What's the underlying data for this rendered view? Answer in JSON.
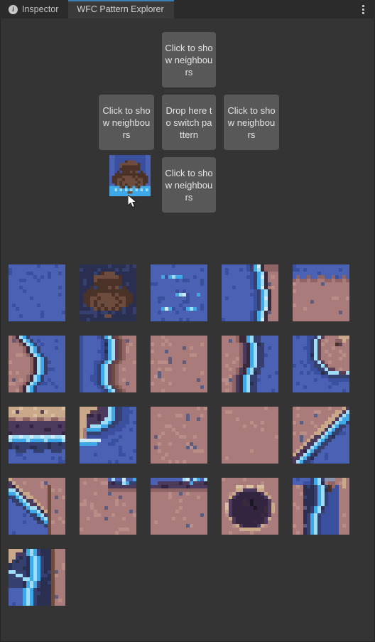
{
  "window": {
    "background": "#343434",
    "panel_border": "#242424"
  },
  "tabbar": {
    "background": "#2b2b2b",
    "active_accent": "#3d7eb5",
    "tabs": [
      {
        "label": "Inspector",
        "icon": "info-icon",
        "active": false
      },
      {
        "label": "WFC Pattern Explorer",
        "icon": null,
        "active": true
      }
    ],
    "menu_icon": "kebab-menu-icon",
    "menu_label": "⋮"
  },
  "neighbour_panel": {
    "button_color": "#585858",
    "text_color": "#e4e4e4",
    "up_label": "Click to show neighbours",
    "left_label": "Click to show neighbours",
    "center_label": "Drop here to switch pattern",
    "right_label": "Click to show neighbours",
    "down_label": "Click to show neighbours",
    "selected_pattern_name": "selected-pattern-thumbnail",
    "cursor": "mouse-cursor"
  },
  "palette": {
    "blue": "#4b62b4",
    "blue_dark": "#3a4f9e",
    "blue_deep": "#2c3a6e",
    "navy": "#36406e",
    "navy_dark": "#2a2f52",
    "cyan": "#3fa8e8",
    "cyan_light": "#9fdcf5",
    "cyan_pale": "#cfe9f7",
    "rose": "#a97b7b",
    "rose_light": "#b88e86",
    "rose_dark": "#8e6464",
    "tan": "#c9a98a",
    "tan_light": "#d8bfa0",
    "brown": "#6d4c3d",
    "brown_dark": "#4a3229",
    "plum": "#5a3f55",
    "plum_dark": "#3b2a3c",
    "purple": "#4b3a5c",
    "purple_dk": "#33253f",
    "dot": "#5d5d80",
    "black": "#1b1724",
    "grey_blue": "#6f7aa0",
    "steel": "#8a93ad"
  },
  "patterns": [
    {
      "id": 0,
      "name": "solid-blue-water"
    },
    {
      "id": 1,
      "name": "dark-boulder-cluster"
    },
    {
      "id": 2,
      "name": "water-with-sparkles"
    },
    {
      "id": 3,
      "name": "shore-diagonal-left"
    },
    {
      "id": 4,
      "name": "shore-horizontal-top"
    },
    {
      "id": 5,
      "name": "shore-curve-right"
    },
    {
      "id": 6,
      "name": "shore-vertical-center"
    },
    {
      "id": 7,
      "name": "solid-sand-speckled"
    },
    {
      "id": 8,
      "name": "shore-vertical-right"
    },
    {
      "id": 9,
      "name": "shore-bay-curve"
    },
    {
      "id": 10,
      "name": "cliff-horizontal-band"
    },
    {
      "id": 11,
      "name": "shore-cove-left"
    },
    {
      "id": 12,
      "name": "sand-speckled-b"
    },
    {
      "id": 13,
      "name": "solid-sand-plain"
    },
    {
      "id": 14,
      "name": "shore-diagonal-corner"
    },
    {
      "id": 15,
      "name": "shore-diagonal-bottomleft"
    },
    {
      "id": 16,
      "name": "sand-with-water-corner"
    },
    {
      "id": 17,
      "name": "sand-with-water-top"
    },
    {
      "id": 18,
      "name": "dark-cave-pit"
    },
    {
      "id": 19,
      "name": "river-vertical-split"
    },
    {
      "id": 20,
      "name": "river-diagonal-cross"
    }
  ],
  "grid": {
    "columns": 5,
    "rows": 5,
    "tile_size": 80,
    "total_patterns": 21
  }
}
